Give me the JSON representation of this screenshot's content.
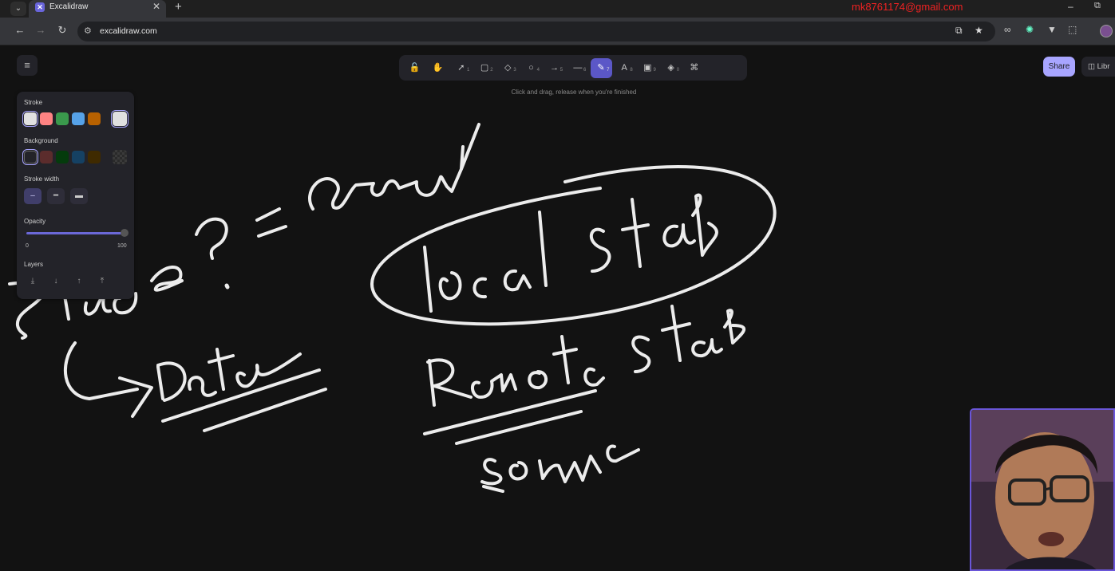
{
  "browser": {
    "tab_title": "Excalidraw",
    "tab_close": "✕",
    "new_tab": "+",
    "tab_dropdown": "⌄",
    "email": "mk8761174@gmail.com",
    "url": "excalidraw.com",
    "window_minimize": "–",
    "window_restore": "⧉",
    "nav": {
      "back": "←",
      "forward": "→",
      "reload": "↻"
    }
  },
  "toolbar": {
    "tools": [
      {
        "name": "lock",
        "glyph": "🔓",
        "key": ""
      },
      {
        "name": "hand",
        "glyph": "✋",
        "key": ""
      },
      {
        "name": "selection",
        "glyph": "➚",
        "key": "1"
      },
      {
        "name": "rectangle",
        "glyph": "▢",
        "key": "2"
      },
      {
        "name": "diamond",
        "glyph": "◇",
        "key": "3"
      },
      {
        "name": "ellipse",
        "glyph": "○",
        "key": "4"
      },
      {
        "name": "arrow",
        "glyph": "→",
        "key": "5"
      },
      {
        "name": "line",
        "glyph": "—",
        "key": "6"
      },
      {
        "name": "draw",
        "glyph": "✎",
        "key": "7"
      },
      {
        "name": "text",
        "glyph": "A",
        "key": "8"
      },
      {
        "name": "image",
        "glyph": "▣",
        "key": "9"
      },
      {
        "name": "eraser",
        "glyph": "◈",
        "key": "0"
      },
      {
        "name": "more",
        "glyph": "⌘",
        "key": ""
      }
    ],
    "active_tool": "draw",
    "hint": "Click and drag, release when you're finished"
  },
  "top_right": {
    "share": "Share",
    "library": "Libr"
  },
  "menu_glyph": "≡",
  "properties": {
    "stroke_label": "Stroke",
    "stroke_colors": [
      "#e0e0e0",
      "#ff8383",
      "#3a994c",
      "#56a2e8",
      "#b76100"
    ],
    "stroke_current": "#e0e0e0",
    "background_label": "Background",
    "background_colors": [
      "transparent",
      "#5b2c2c",
      "#043b0c",
      "#154163",
      "#3f2a00"
    ],
    "stroke_width_label": "Stroke width",
    "opacity_label": "Opacity",
    "opacity_min": "0",
    "opacity_max": "100",
    "opacity_value": 100,
    "layers_label": "Layers",
    "layer_glyphs": [
      "⤓",
      "↓",
      "↑",
      "⤒"
    ]
  },
  "colors": {
    "accent": "#6965db",
    "share": "#a8a5ff",
    "canvas": "#121212"
  }
}
